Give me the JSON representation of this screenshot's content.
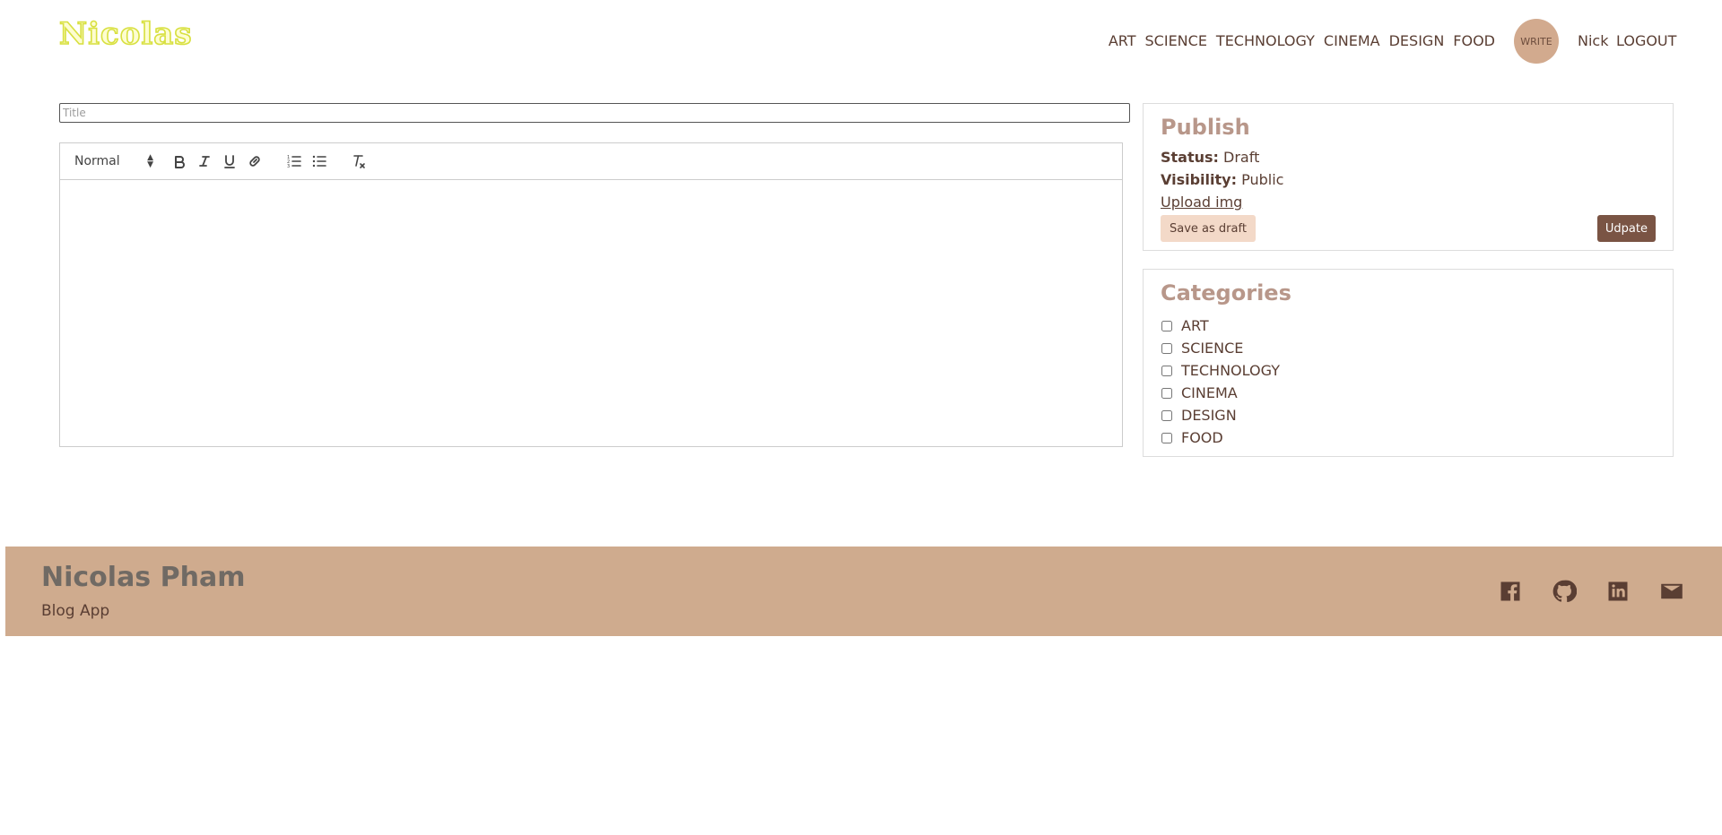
{
  "navbar": {
    "logo": "Nicolas",
    "links": [
      "ART",
      "SCIENCE",
      "TECHNOLOGY",
      "CINEMA",
      "DESIGN",
      "FOOD"
    ],
    "write_label": "WRITE",
    "user": "Nick",
    "logout": "LOGOUT"
  },
  "editor": {
    "title_placeholder": "Title",
    "title_value": "",
    "heading_select": "Normal",
    "toolbar_icons": [
      "bold-icon",
      "italic-icon",
      "underline-icon",
      "link-icon",
      "ordered-list-icon",
      "bullet-list-icon",
      "clear-format-icon"
    ],
    "body": ""
  },
  "publish": {
    "title": "Publish",
    "status_label": "Status:",
    "status_value": "Draft",
    "visibility_label": "Visibility:",
    "visibility_value": "Public",
    "upload_label": "Upload img",
    "save_draft_label": "Save as draft",
    "update_label": "Udpate"
  },
  "categories": {
    "title": "Categories",
    "items": [
      {
        "label": "ART",
        "checked": false
      },
      {
        "label": "SCIENCE",
        "checked": false
      },
      {
        "label": "TECHNOLOGY",
        "checked": false
      },
      {
        "label": "CINEMA",
        "checked": false
      },
      {
        "label": "DESIGN",
        "checked": false
      },
      {
        "label": "FOOD",
        "checked": false
      }
    ]
  },
  "footer": {
    "name": "Nicolas Pham",
    "subtitle": "Blog App",
    "icons": [
      "facebook-icon",
      "github-icon",
      "linkedin-icon",
      "mail-icon"
    ]
  },
  "colors": {
    "accent": "#d2aa8e",
    "footer_bg": "#cfab8e",
    "button_dark": "#7a5444",
    "button_light": "#f3d9c8",
    "text": "#5a3e33",
    "heading_muted": "#b8978a",
    "logo_yellow": "#d8e040"
  }
}
